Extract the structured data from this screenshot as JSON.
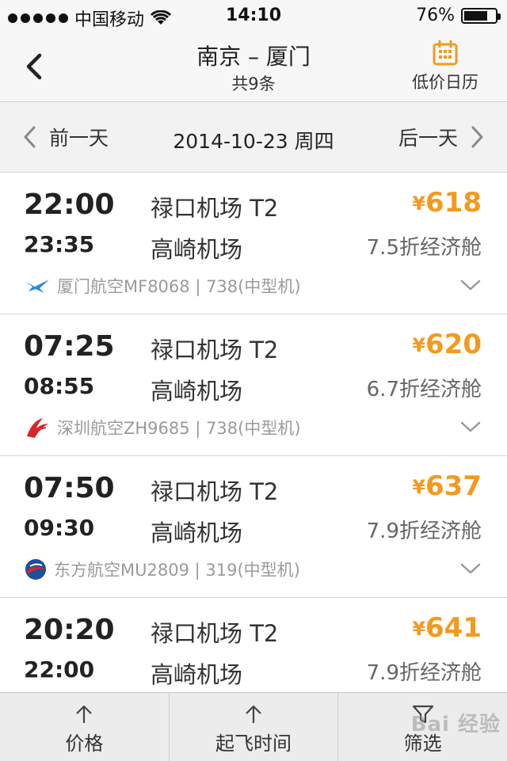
{
  "status_bar": {
    "carrier": "中国移动",
    "time": "14:10",
    "battery": "76%",
    "battery_level": 0.76
  },
  "nav": {
    "title": "南京 – 厦门",
    "subtitle": "共9条",
    "calendar_label": "低价日历",
    "back_icon": "chevron-left-icon",
    "calendar_icon": "calendar-icon",
    "accent_color": "#f39a1e"
  },
  "date_bar": {
    "prev_label": "前一天",
    "current_date": "2014-10-23 周四",
    "next_label": "后一天"
  },
  "flights": [
    {
      "dep_time": "22:00",
      "arr_time": "23:35",
      "dep_airport": "禄口机场 T2",
      "arr_airport": "高崎机场",
      "currency": "¥",
      "price": "618",
      "cabin": "7.5折经济舱",
      "airline_info": "厦门航空MF8068 | 738(中型机)",
      "airline_logo": "xiamen-airlines-logo-icon"
    },
    {
      "dep_time": "07:25",
      "arr_time": "08:55",
      "dep_airport": "禄口机场 T2",
      "arr_airport": "高崎机场",
      "currency": "¥",
      "price": "620",
      "cabin": "6.7折经济舱",
      "airline_info": "深圳航空ZH9685 | 738(中型机)",
      "airline_logo": "shenzhen-airlines-logo-icon"
    },
    {
      "dep_time": "07:50",
      "arr_time": "09:30",
      "dep_airport": "禄口机场 T2",
      "arr_airport": "高崎机场",
      "currency": "¥",
      "price": "637",
      "cabin": "7.9折经济舱",
      "airline_info": "东方航空MU2809 | 319(中型机)",
      "airline_logo": "china-eastern-logo-icon"
    },
    {
      "dep_time": "20:20",
      "arr_time": "22:00",
      "dep_airport": "禄口机场 T2",
      "arr_airport": "高崎机场",
      "currency": "¥",
      "price": "641",
      "cabin": "7.9折经济舱"
    }
  ],
  "tab_bar": {
    "tabs": [
      {
        "label": "价格",
        "icon": "arrow-up-icon"
      },
      {
        "label": "起飞时间",
        "icon": "arrow-up-icon"
      },
      {
        "label": "筛选",
        "icon": "filter-icon"
      }
    ]
  },
  "watermark": "Bai 经验"
}
